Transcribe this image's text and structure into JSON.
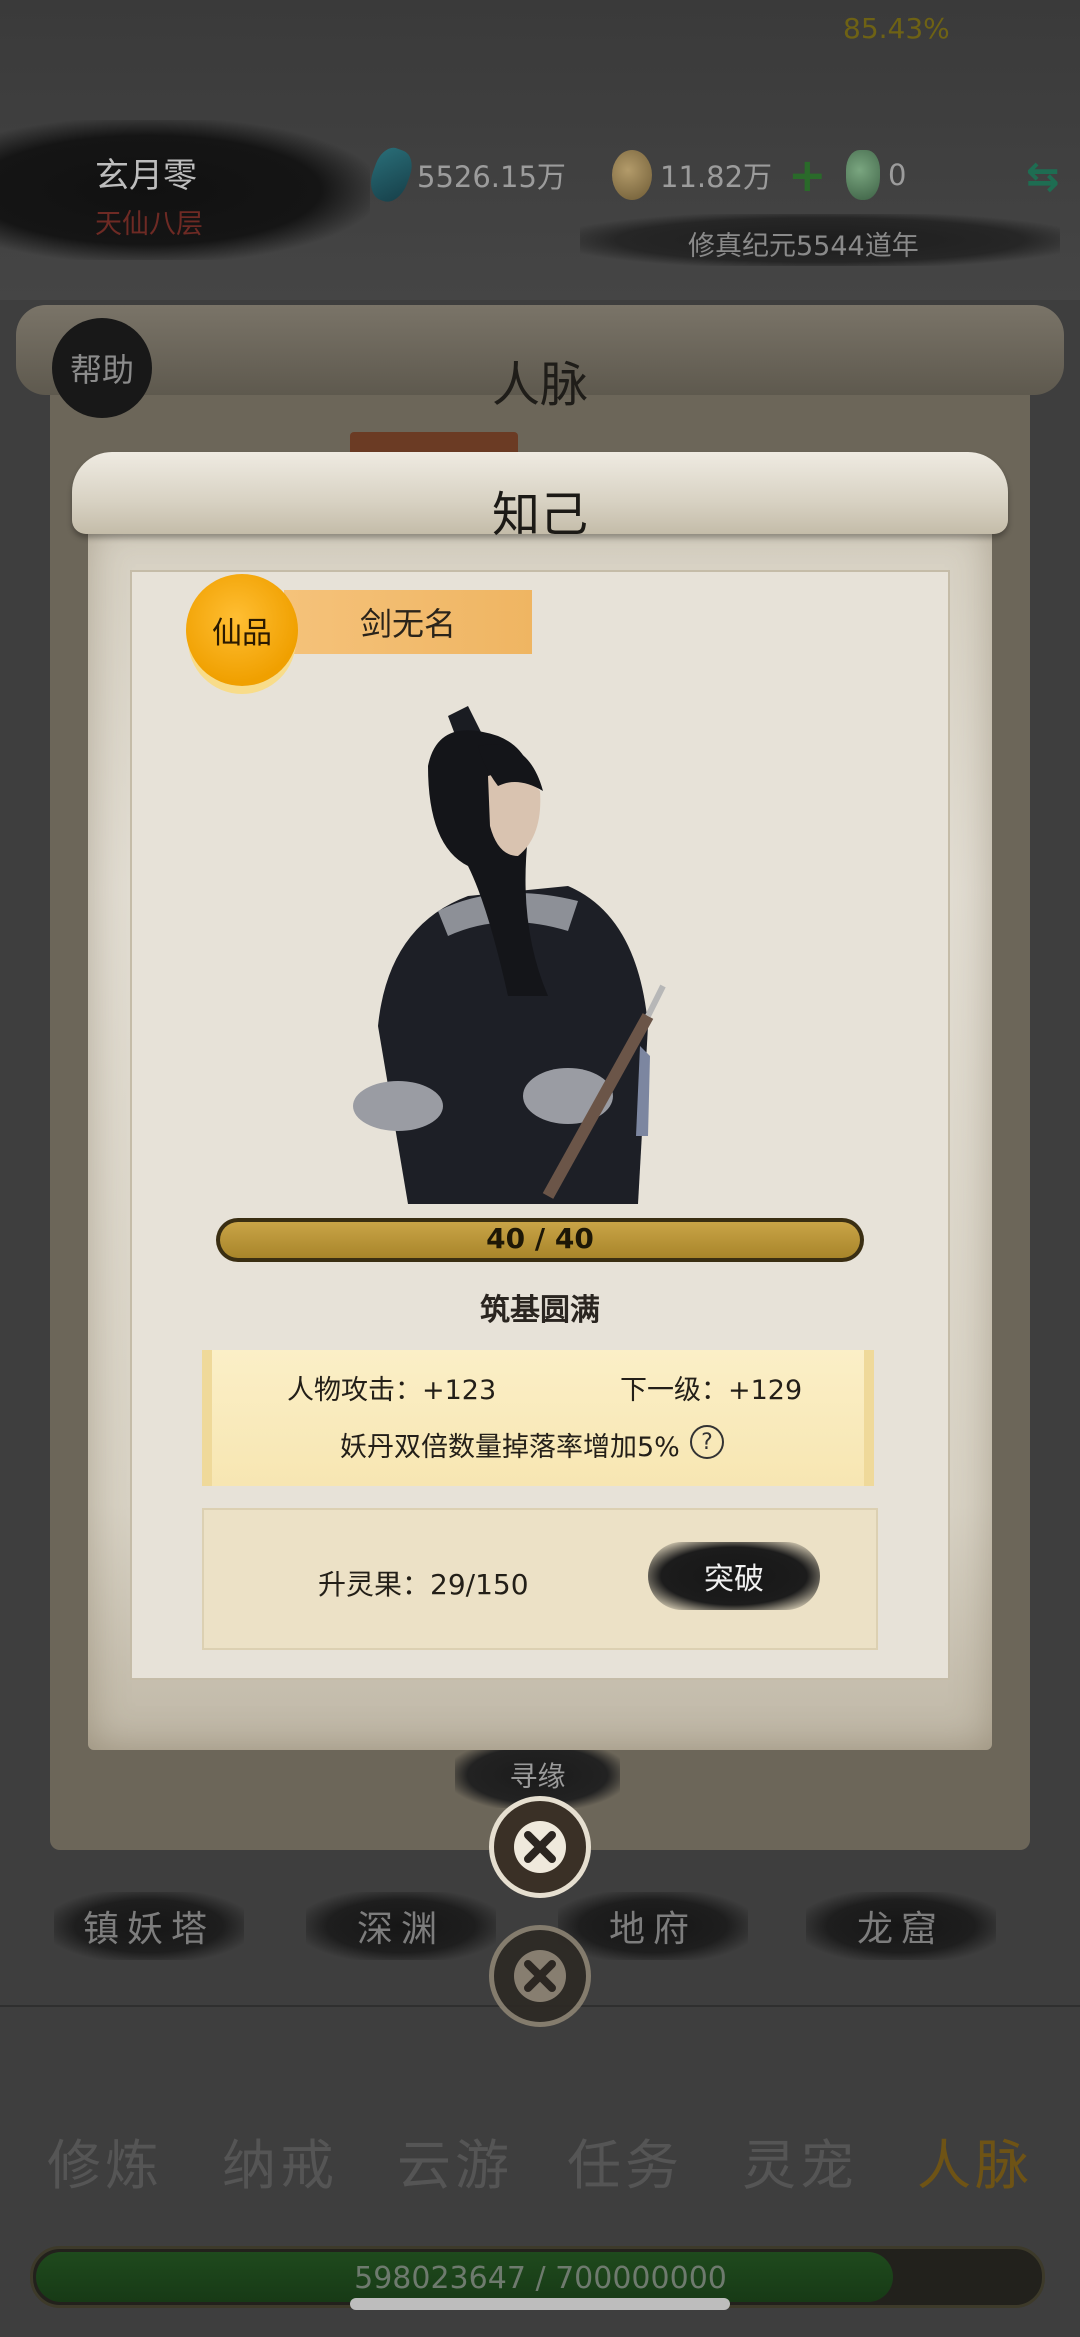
{
  "player": {
    "name": "玄月零",
    "realm": "天仙八层"
  },
  "resources": {
    "spirit_stones": "5526.15万",
    "gold": "11.82万",
    "jade": "0",
    "add_label": "+"
  },
  "era": "修真纪元5544道年",
  "background_panel": {
    "title": "人脉",
    "help_label": "帮助",
    "seek_label": "寻缘"
  },
  "zones": [
    "镇妖塔",
    "深渊",
    "地府",
    "龙窟"
  ],
  "nav": {
    "items": [
      "修炼",
      "纳戒",
      "云游",
      "任务",
      "灵宠",
      "人脉"
    ],
    "active_index": 5
  },
  "xp": {
    "text": "598023647 / 700000000",
    "percent_label": "85.43%",
    "fraction": 0.8543
  },
  "dialog": {
    "title": "知己",
    "grade": "仙品",
    "name": "剑无名",
    "level_text": "40 / 40",
    "level_fraction": 1.0,
    "realm": "筑基圆满",
    "attack": "人物攻击：+123",
    "next_level": "下一级：+129",
    "effect": "妖丹双倍数量掉落率增加5%",
    "effect_help": "?",
    "fruit": "升灵果：29/150",
    "break_label": "突破"
  },
  "colors": {
    "accent_gold": "#f0a000",
    "xp_green": "#1f4a1d",
    "level_gold": "#c9a447"
  }
}
